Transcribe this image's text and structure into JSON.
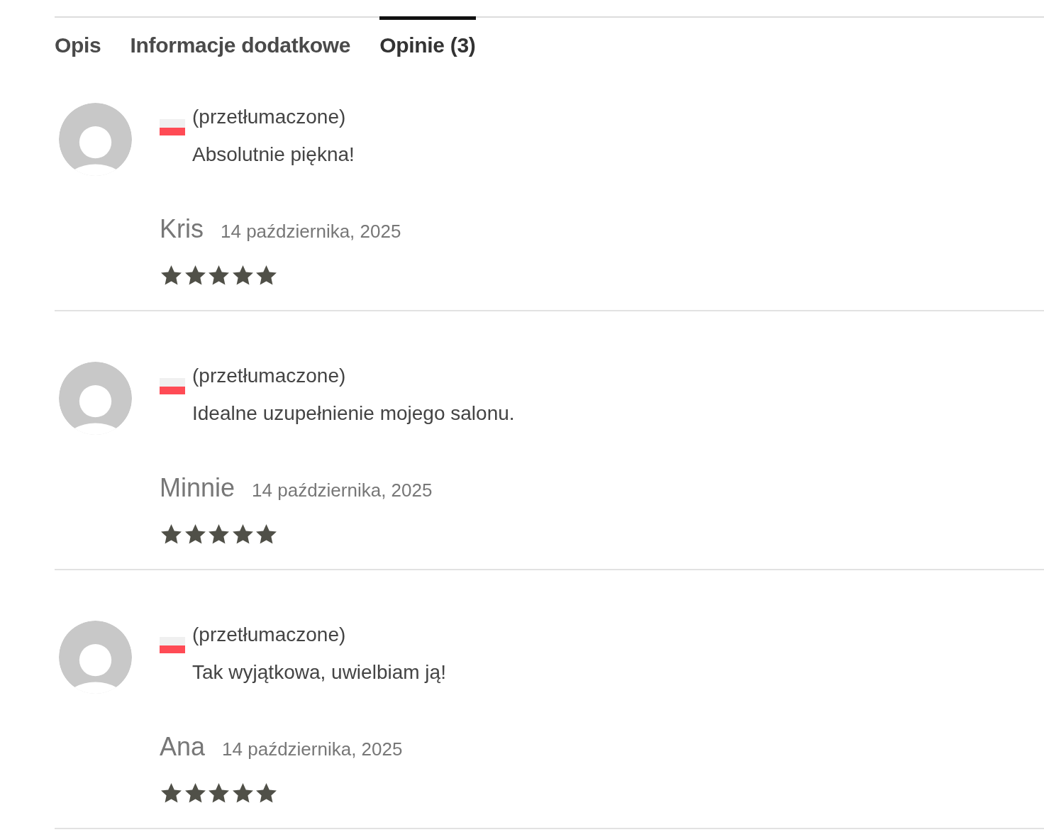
{
  "tabs": [
    {
      "label": "Opis",
      "selected": false
    },
    {
      "label": "Informacje dodatkowe",
      "selected": false
    },
    {
      "label": "Opinie (3)",
      "selected": true
    }
  ],
  "reviews": [
    {
      "translated_label": "(przetłumaczone)",
      "text": "Absolutnie piękna!",
      "author": "Kris",
      "date": "14 października, 2025",
      "stars": 5
    },
    {
      "translated_label": "(przetłumaczone)",
      "text": "Idealne uzupełnienie mojego salonu.",
      "author": "Minnie",
      "date": "14 października, 2025",
      "stars": 5
    },
    {
      "translated_label": "(przetłumaczone)",
      "text": "Tak wyjątkowa, uwielbiam ją!",
      "author": "Ana",
      "date": "14 października, 2025",
      "stars": 5
    }
  ]
}
